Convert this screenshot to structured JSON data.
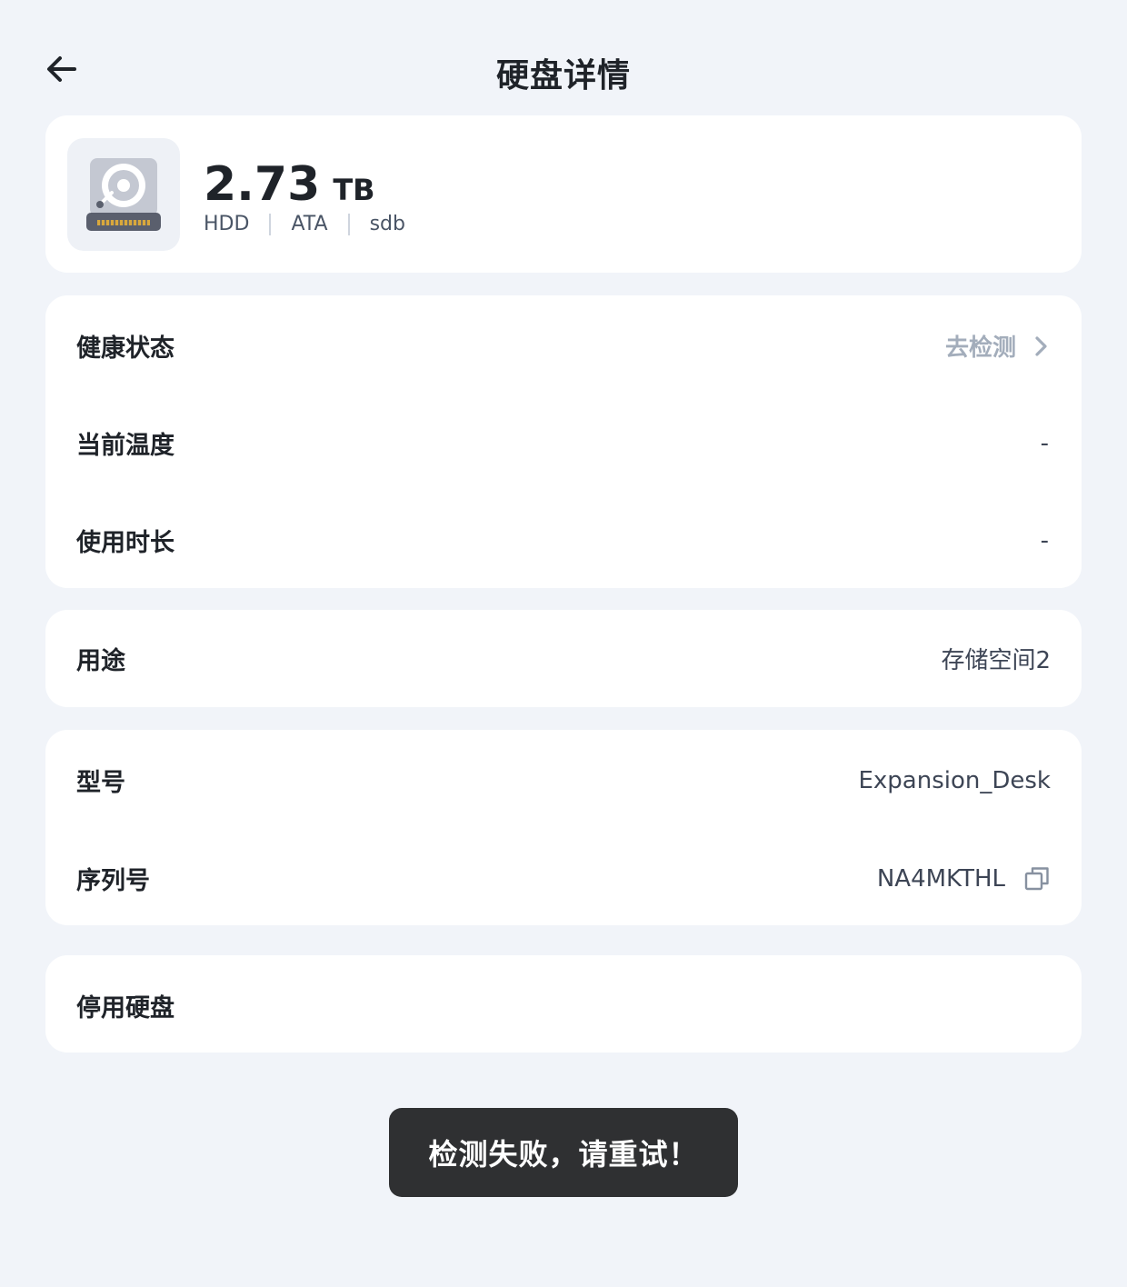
{
  "header": {
    "title": "硬盘详情",
    "back_icon": "arrow-left-icon"
  },
  "disk": {
    "icon": "hard-disk-icon",
    "capacity": "2.73",
    "unit": "TB",
    "tags": [
      "HDD",
      "ATA",
      "sdb"
    ]
  },
  "status": {
    "health_label": "健康状态",
    "health_action": "去检测",
    "temp_label": "当前温度",
    "temp_value": "-",
    "uptime_label": "使用时长",
    "uptime_value": "-"
  },
  "usage": {
    "label": "用途",
    "value": "存储空间2"
  },
  "info": {
    "model_label": "型号",
    "model_value": "Expansion_Desk",
    "serial_label": "序列号",
    "serial_value": "NA4MKTHL",
    "copy_icon": "copy-icon"
  },
  "actions": {
    "disable_label": "停用硬盘"
  },
  "toast": {
    "message": "检测失败，请重试！"
  },
  "colors": {
    "background": "#f1f4f9",
    "card": "#ffffff",
    "muted_text": "#a3adbb",
    "toast_bg": "#2f3032"
  }
}
